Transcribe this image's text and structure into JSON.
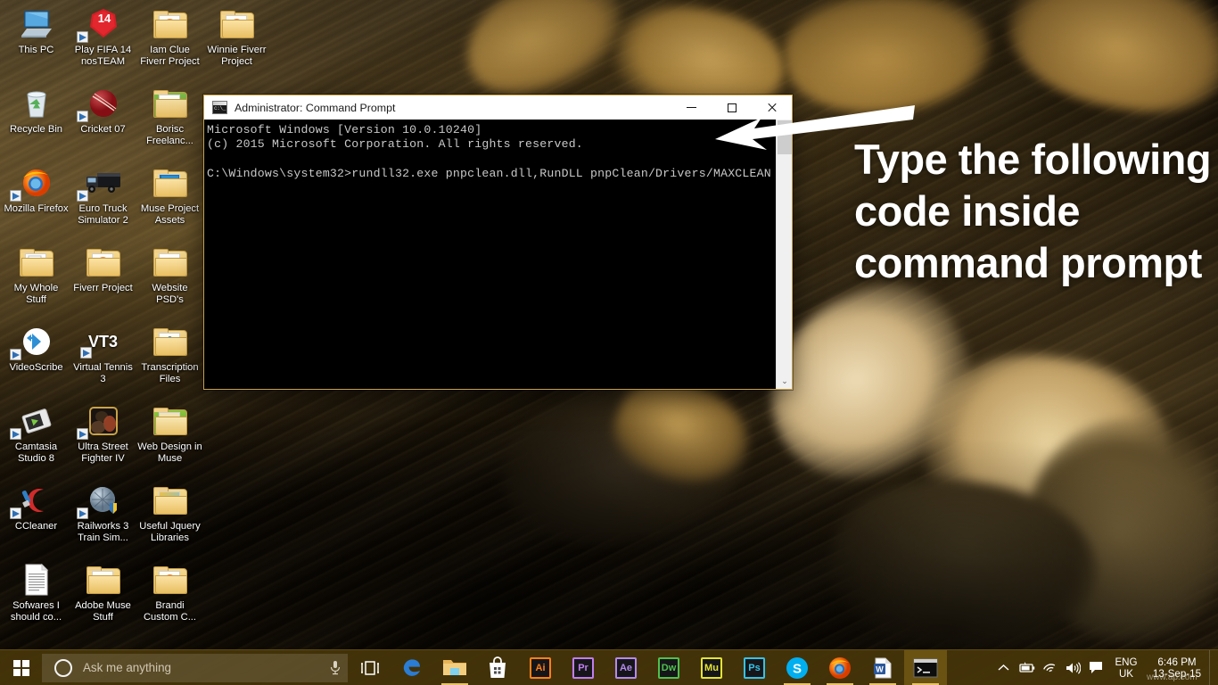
{
  "desktop": {
    "icons": [
      {
        "label": "This PC",
        "icon": "computer-icon",
        "shortcut": false
      },
      {
        "label": "Play FIFA 14 nosTEAM",
        "icon": "fifa-14-icon",
        "shortcut": true
      },
      {
        "label": "Iam Clue Fiverr Project",
        "icon": "folder-firefox-icon",
        "shortcut": false
      },
      {
        "label": "Winnie Fiverr Project",
        "icon": "folder-firefox-icon",
        "shortcut": false
      },
      {
        "label": "Recycle Bin",
        "icon": "recycle-bin-icon",
        "shortcut": false
      },
      {
        "label": "Cricket 07",
        "icon": "cricket-ball-icon",
        "shortcut": true
      },
      {
        "label": "Borisc Freelanc...",
        "icon": "folder-document-icon",
        "shortcut": false
      },
      {
        "label": "Mozilla Firefox",
        "icon": "firefox-icon",
        "shortcut": true
      },
      {
        "label": "Euro Truck Simulator 2",
        "icon": "truck-icon",
        "shortcut": true
      },
      {
        "label": "Muse Project Assets",
        "icon": "folder-muse-icon",
        "shortcut": false
      },
      {
        "label": "My Whole Stuff",
        "icon": "folder-files-icon",
        "shortcut": false
      },
      {
        "label": "Fiverr Project",
        "icon": "folder-firefox-icon",
        "shortcut": false
      },
      {
        "label": "Website PSD's",
        "icon": "folder-plain-icon",
        "shortcut": false
      },
      {
        "label": "VideoScribe",
        "icon": "videoscribe-icon",
        "shortcut": true
      },
      {
        "label": "Virtual Tennis 3",
        "icon": "vt3-icon",
        "shortcut": true,
        "badge": "VT3"
      },
      {
        "label": "Transcription Files",
        "icon": "folder-audio-icon",
        "shortcut": false
      },
      {
        "label": "Camtasia Studio 8",
        "icon": "camtasia-icon",
        "shortcut": true
      },
      {
        "label": "Ultra Street Fighter IV",
        "icon": "street-fighter-icon",
        "shortcut": true
      },
      {
        "label": "Web Design in Muse",
        "icon": "folder-webdesign-icon",
        "shortcut": false
      },
      {
        "label": "CCleaner",
        "icon": "ccleaner-icon",
        "shortcut": true
      },
      {
        "label": "Railworks 3 Train Sim...",
        "icon": "railworks-icon",
        "shortcut": true
      },
      {
        "label": "Useful Jquery Libraries",
        "icon": "folder-jquery-icon",
        "shortcut": false
      },
      {
        "label": "Sofwares I should co...",
        "icon": "text-document-icon",
        "shortcut": false
      },
      {
        "label": "Adobe Muse Stuff",
        "icon": "folder-document-icon",
        "shortcut": false
      },
      {
        "label": "Brandi Custom C...",
        "icon": "folder-firefox-icon",
        "shortcut": false
      }
    ]
  },
  "cmd_window": {
    "title": "Administrator: Command Prompt",
    "icon": "console-icon",
    "minimize_label": "Minimize",
    "maximize_label": "Maximize",
    "close_label": "Close",
    "console_text": "Microsoft Windows [Version 10.0.10240]\n(c) 2015 Microsoft Corporation. All rights reserved.\n\nC:\\Windows\\system32>rundll32.exe pnpclean.dll,RunDLL pnpClean/Drivers/MAXCLEAN",
    "scroll_down_glyph": "⌄"
  },
  "annotation": {
    "text": "Type the following code inside command prompt",
    "color": "#ffffff",
    "arrow": "left-pointing-arrow"
  },
  "taskbar": {
    "start_label": "Start",
    "search": {
      "placeholder": "Ask me anything",
      "value": "",
      "cortana_label": "Cortana",
      "mic_label": "Microphone"
    },
    "task_view_label": "Task View",
    "apps": [
      {
        "name": "microsoft-edge",
        "label": "e",
        "color": "#2b7cd3",
        "running": false
      },
      {
        "name": "file-explorer",
        "label": "",
        "color": "#e8b457",
        "running": true
      },
      {
        "name": "microsoft-store",
        "label": "",
        "color": "#ffffff",
        "running": false
      },
      {
        "name": "adobe-illustrator",
        "label": "Ai",
        "color": "#ff7f18",
        "running": false
      },
      {
        "name": "adobe-premiere-pro",
        "label": "Pr",
        "color": "#c07df0",
        "running": false
      },
      {
        "name": "adobe-after-effects",
        "label": "Ae",
        "color": "#b58aed",
        "running": false
      },
      {
        "name": "adobe-dreamweaver",
        "label": "Dw",
        "color": "#4ec14e",
        "running": false
      },
      {
        "name": "adobe-muse",
        "label": "Mu",
        "color": "#e4e432",
        "running": false
      },
      {
        "name": "adobe-photoshop",
        "label": "Ps",
        "color": "#34c3e8",
        "running": false
      },
      {
        "name": "skype",
        "label": "S",
        "color": "#00aff0",
        "running": true
      },
      {
        "name": "mozilla-firefox",
        "label": "",
        "color": "#e66000",
        "running": true
      },
      {
        "name": "microsoft-word",
        "label": "W",
        "color": "#2b579a",
        "running": true
      },
      {
        "name": "command-prompt",
        "label": "",
        "color": "#1b1b1b",
        "running": true,
        "active": true
      }
    ],
    "tray": {
      "show_hidden_label": "Show hidden icons",
      "battery_label": "Battery",
      "network_label": "Network",
      "volume_label": "Volume",
      "action_center_label": "Action Center",
      "language_line1": "ENG",
      "language_line2": "UK",
      "time": "6:46 PM",
      "date": "13-Sep-15",
      "watermark": "www.ap.com"
    }
  }
}
